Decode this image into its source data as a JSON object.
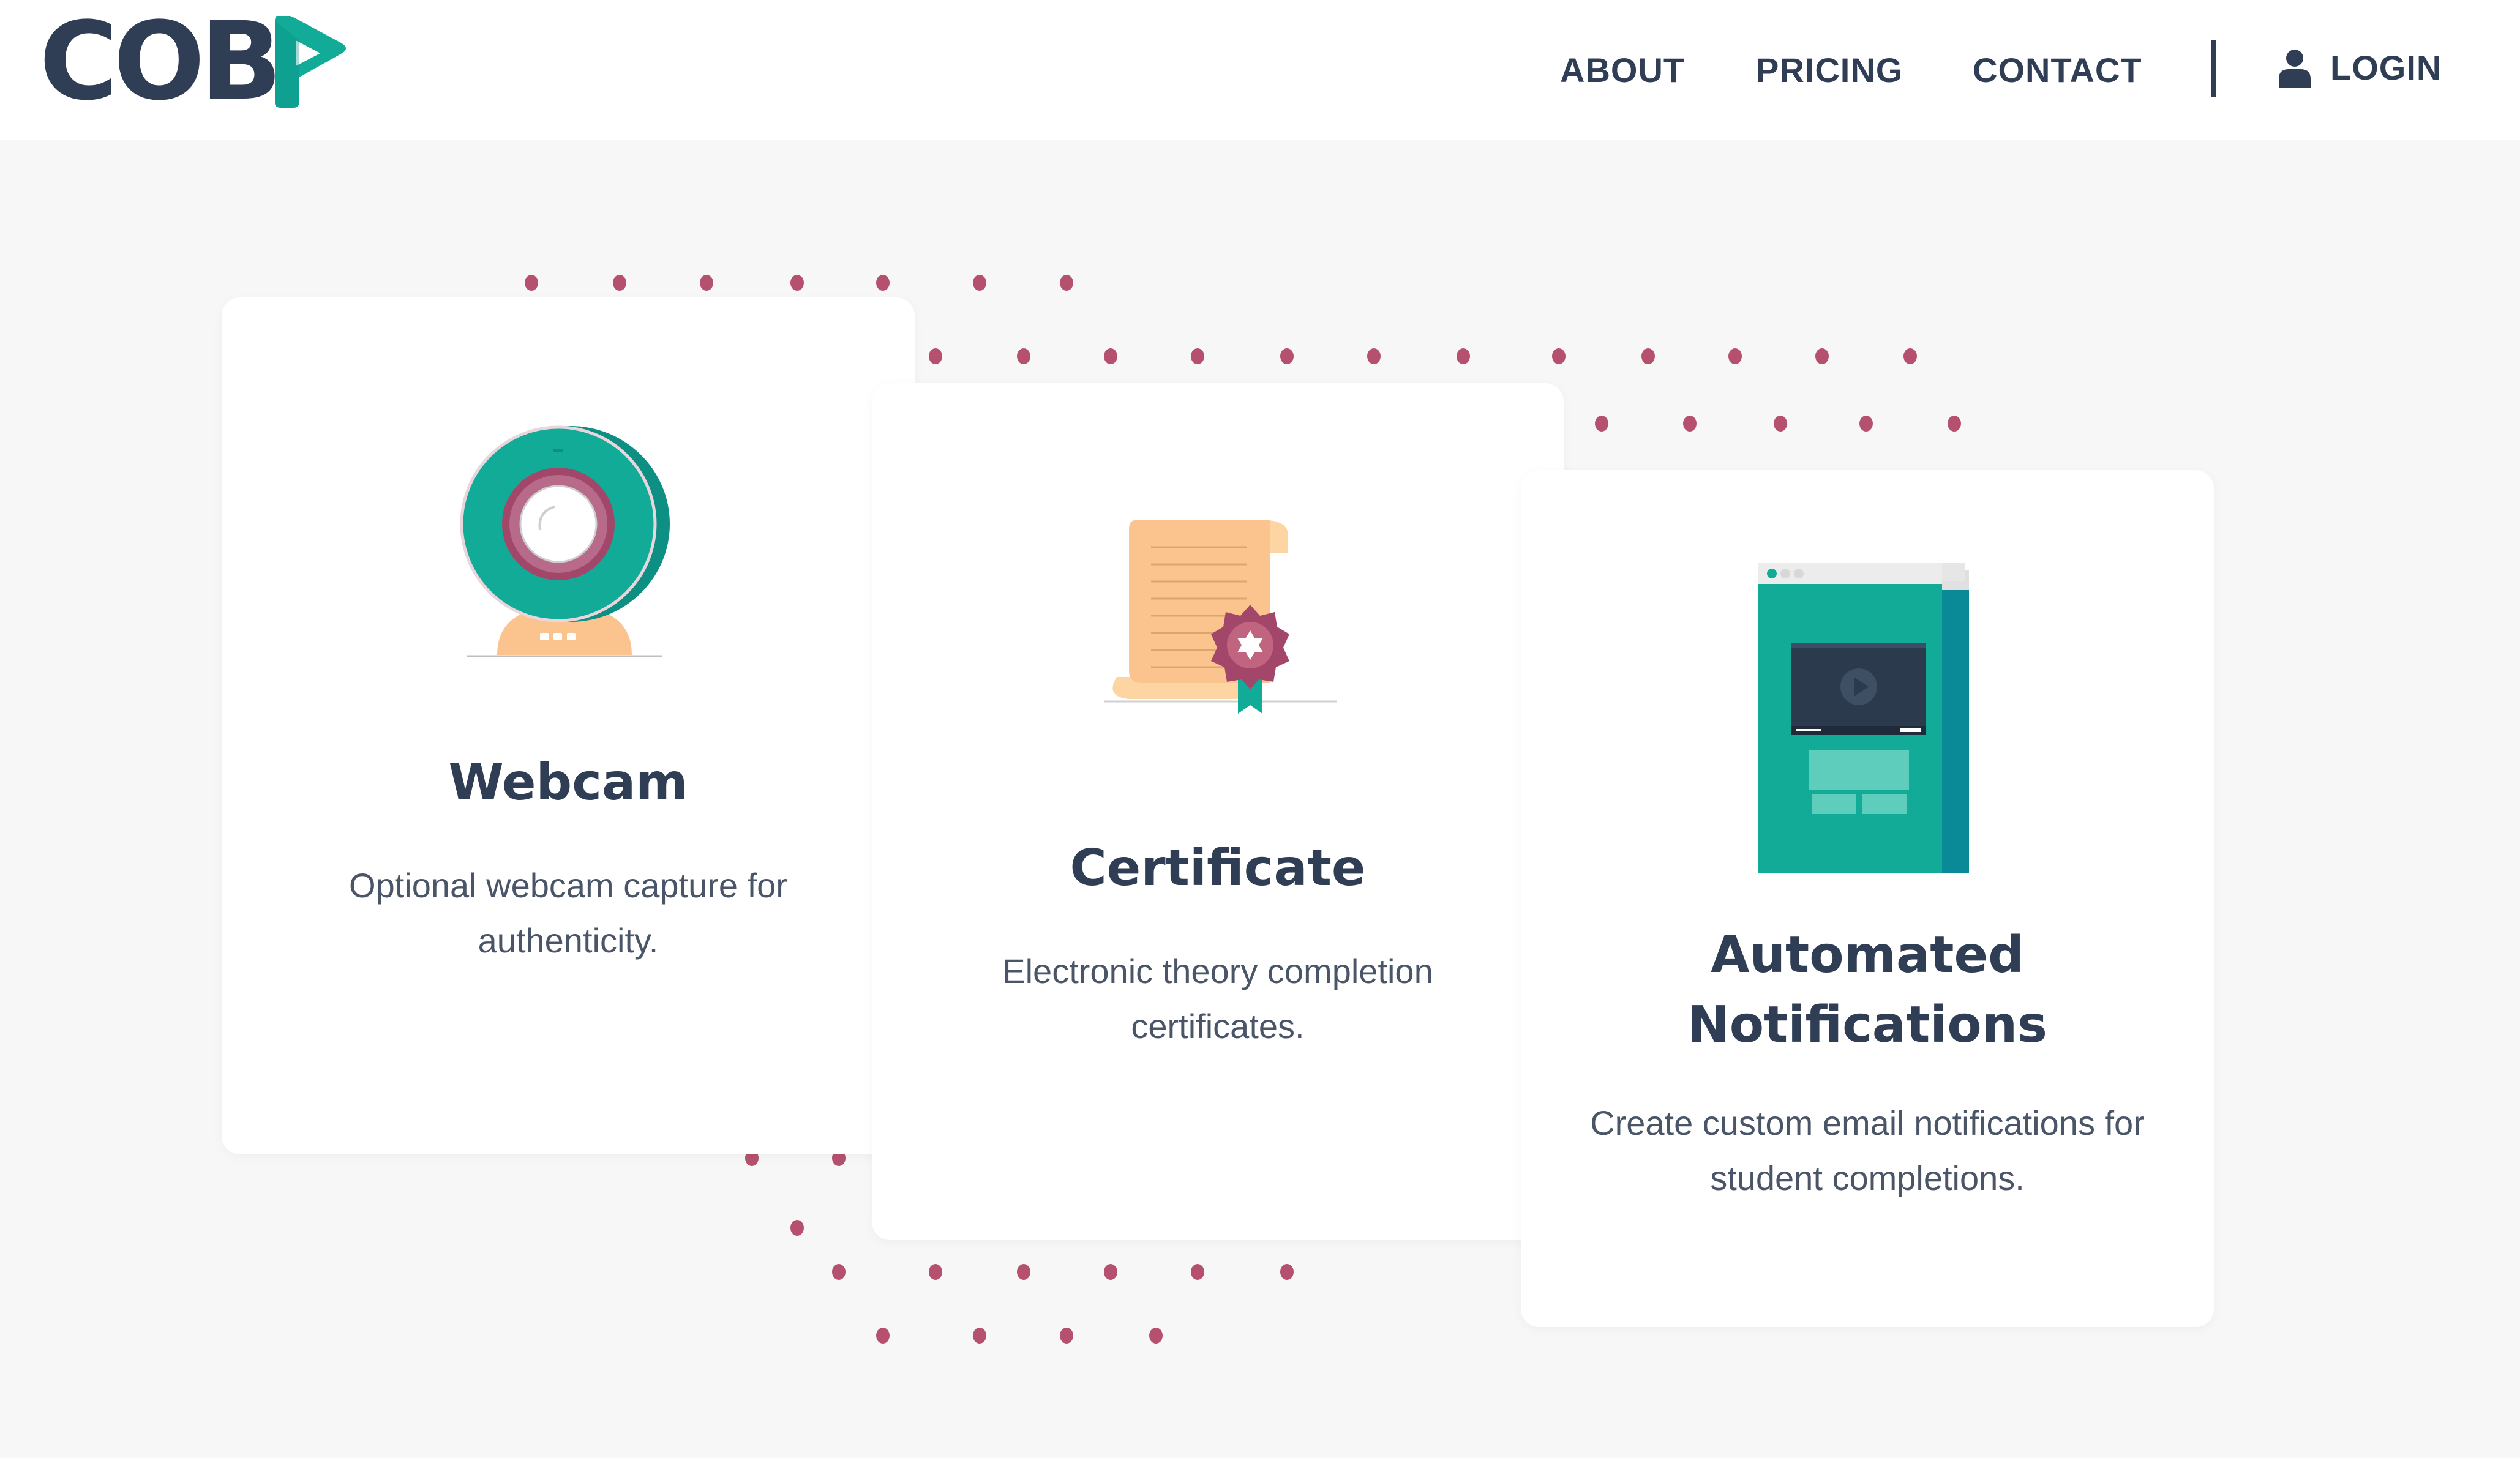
{
  "brand": {
    "logo_text": "COB",
    "logo_color": "#2f3d55",
    "accent_color": "#11ab95"
  },
  "nav": {
    "about": "ABOUT",
    "pricing": "PRICING",
    "contact": "CONTACT",
    "login": "LOGIN"
  },
  "features": [
    {
      "title": "Webcam",
      "description": "Optional webcam capture for authenticity.",
      "icon": "webcam-icon"
    },
    {
      "title": "Certificate",
      "description": "Electronic theory completion certificates.",
      "icon": "certificate-icon"
    },
    {
      "title": "Automated Notifications",
      "description": "Create custom email notifications for student completions.",
      "icon": "notification-screen-icon"
    }
  ],
  "colors": {
    "dot": "#b5516f",
    "teal": "#12ab97",
    "heading": "#2f3d55",
    "background": "#f7f7f7"
  }
}
